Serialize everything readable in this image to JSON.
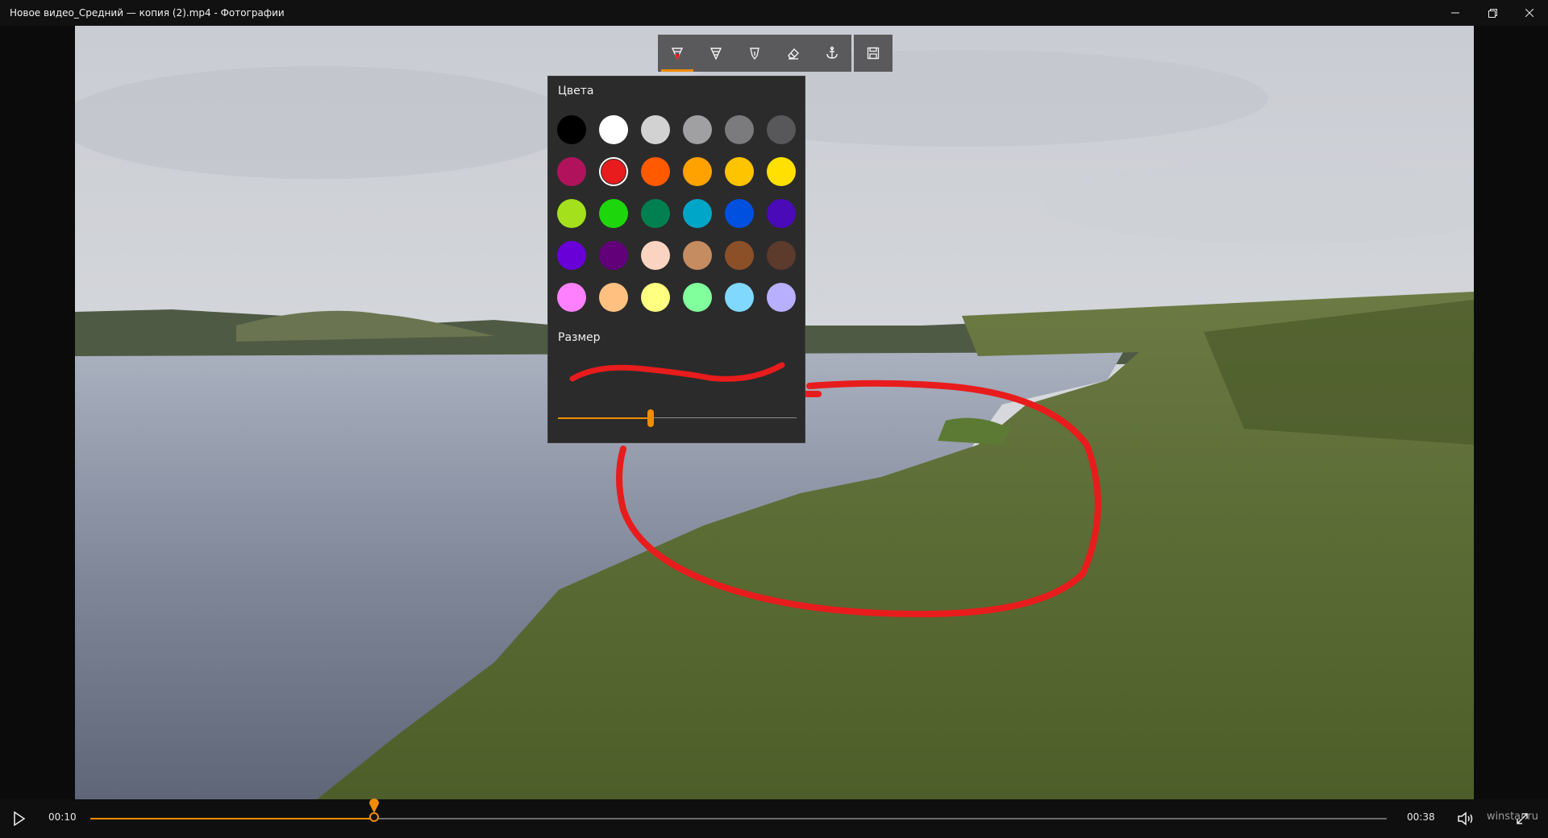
{
  "window": {
    "title": "Новое видео_Средний — копия (2).mp4 - Фотографии"
  },
  "toolbar": {
    "tools": [
      {
        "name": "ballpoint-pen",
        "active": true
      },
      {
        "name": "pencil",
        "active": false
      },
      {
        "name": "calligraphy-pen",
        "active": false
      },
      {
        "name": "eraser",
        "active": false
      },
      {
        "name": "anchor",
        "active": false
      }
    ],
    "save": "save-icon"
  },
  "flyout": {
    "colors_label": "Цвета",
    "size_label": "Размер",
    "selected_color": "#e81c1c",
    "size_value": 0.39,
    "colors": [
      [
        "#000000",
        "#ffffff",
        "#d2d2d2",
        "#a0a0a2",
        "#7b7b7d",
        "#58585a"
      ],
      [
        "#b0135c",
        "#e81c1c",
        "#ff5a00",
        "#ffa200",
        "#ffc400",
        "#ffe000"
      ],
      [
        "#a4e01c",
        "#1ed60c",
        "#008050",
        "#00a6c8",
        "#0050e0",
        "#4a0ab8"
      ],
      [
        "#6a00d8",
        "#62007a",
        "#fad4c0",
        "#c48c60",
        "#8c5028",
        "#5c3a2c"
      ],
      [
        "#ff80ff",
        "#ffc080",
        "#ffff80",
        "#80ff9c",
        "#80d8ff",
        "#b8b0ff"
      ]
    ]
  },
  "playback": {
    "current_time": "00:10",
    "total_time": "00:38",
    "progress": 0.2187
  },
  "watermark": "winstar.ru",
  "accent": "#f28c00"
}
